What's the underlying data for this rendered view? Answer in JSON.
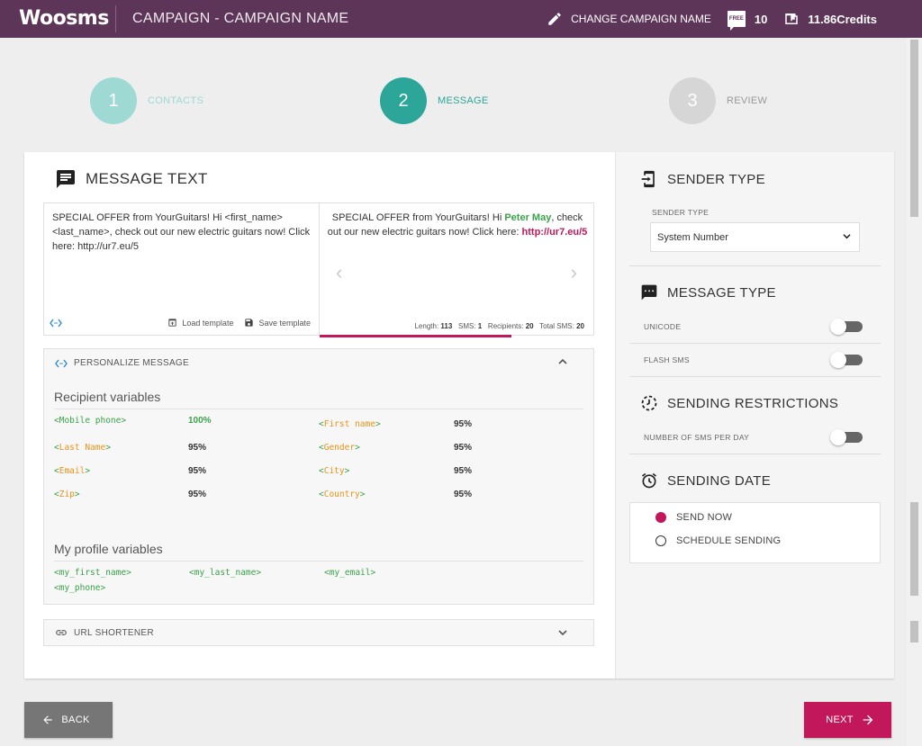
{
  "app": {
    "logo": "Woosms",
    "title": "CAMPAIGN - CAMPAIGN NAME"
  },
  "header": {
    "change_name": "CHANGE CAMPAIGN NAME",
    "free_badge": "FREE",
    "free_count": "10",
    "credits": "11.86Credits"
  },
  "steps": [
    {
      "number": "1",
      "label": "CONTACTS",
      "state": "done",
      "color": "#9ed9d3"
    },
    {
      "number": "2",
      "label": "MESSAGE",
      "state": "active",
      "color": "#2ba699"
    },
    {
      "number": "3",
      "label": "REVIEW",
      "state": "pending",
      "color": "#d6d6d6"
    }
  ],
  "message": {
    "title": "MESSAGE TEXT",
    "text": "SPECIAL OFFER from YourGuitars! Hi <first_name> <last_name>, check out our new electric guitars now! Click here: http://ur7.eu/5",
    "load_template": "Load template",
    "save_template": "Save template",
    "preview": {
      "before": "SPECIAL OFFER from YourGuitars! Hi ",
      "name": "Peter May",
      "middle": ", check out our new electric guitars now! Click here: ",
      "url": "http://ur7.eu/5"
    },
    "stats": {
      "length_label": "Length:",
      "length": "113",
      "sms_label": "SMS:",
      "sms": "1",
      "recipients_label": "Recipients:",
      "recipients": "20",
      "total_label": "Total SMS:",
      "total": "20"
    }
  },
  "personalize": {
    "title": "PERSONALIZE MESSAGE",
    "recipient_title": "Recipient variables",
    "recipient_vars": [
      {
        "name": "Mobile phone",
        "pct": "100%"
      },
      {
        "name": "First name",
        "pct": "95%"
      },
      {
        "name": "Last Name",
        "pct": "95%"
      },
      {
        "name": "Gender",
        "pct": "95%"
      },
      {
        "name": "Email",
        "pct": "95%"
      },
      {
        "name": "City",
        "pct": "95%"
      },
      {
        "name": "Zip",
        "pct": "95%"
      },
      {
        "name": "Country",
        "pct": "95%"
      }
    ],
    "profile_title": "My profile variables",
    "profile_vars": [
      "<my_first_name>",
      "<my_last_name>",
      "<my_email>",
      "<my_phone>"
    ]
  },
  "url_shortener": {
    "title": "URL SHORTENER"
  },
  "sender": {
    "title": "SENDER TYPE",
    "label": "SENDER TYPE",
    "value": "System Number"
  },
  "message_type": {
    "title": "MESSAGE TYPE",
    "unicode": "UNICODE",
    "flash": "FLASH SMS"
  },
  "restrictions": {
    "title": "SENDING RESTRICTIONS",
    "per_day": "NUMBER OF SMS PER DAY"
  },
  "sending_date": {
    "title": "SENDING DATE",
    "send_now": "SEND NOW",
    "schedule": "SCHEDULE SENDING",
    "selected": "send_now"
  },
  "footer": {
    "back": "BACK",
    "next": "NEXT"
  },
  "colors": {
    "header": "#5c3558",
    "accent": "#c2185b",
    "teal": "#2ba699",
    "green": "#3aa34a",
    "orange": "#e8931a"
  }
}
